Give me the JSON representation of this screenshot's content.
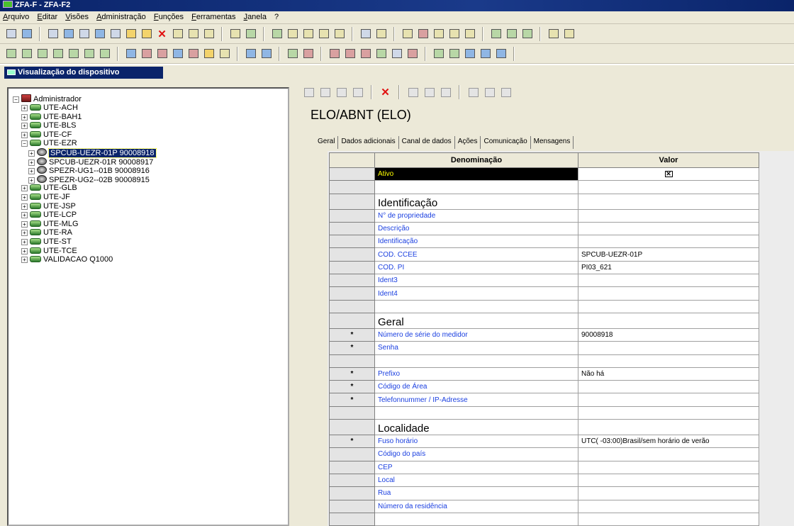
{
  "window": {
    "title": "ZFA-F - ZFA-F2"
  },
  "menu": [
    "Arquivo",
    "Editar",
    "Visões",
    "Administração",
    "Funções",
    "Ferramentas",
    "Janela",
    "?"
  ],
  "panel": {
    "title": "Visualização do dispositivo"
  },
  "tree": {
    "root": "Administrador",
    "items": [
      {
        "label": "UTE-ACH",
        "expanded": false
      },
      {
        "label": "UTE-BAH1",
        "expanded": false
      },
      {
        "label": "UTE-BLS",
        "expanded": false
      },
      {
        "label": "UTE-CF",
        "expanded": false
      },
      {
        "label": "UTE-EZR",
        "expanded": true
      },
      {
        "label": "SPCUB-UEZR-01P  90008918",
        "child": true,
        "selected": true
      },
      {
        "label": "SPCUB-UEZR-01R  90008917",
        "child": true
      },
      {
        "label": "SPEZR-UG1--01B  90008916",
        "child": true
      },
      {
        "label": "SPEZR-UG2--02B  90008915",
        "child": true
      },
      {
        "label": "UTE-GLB",
        "expanded": false
      },
      {
        "label": "UTE-JF",
        "expanded": false
      },
      {
        "label": "UTE-JSP",
        "expanded": false
      },
      {
        "label": "UTE-LCP",
        "expanded": false
      },
      {
        "label": "UTE-MLG",
        "expanded": false
      },
      {
        "label": "UTE-RA",
        "expanded": false
      },
      {
        "label": "UTE-ST",
        "expanded": false
      },
      {
        "label": "UTE-TCE",
        "expanded": false
      },
      {
        "label": "VALIDACAO Q1000",
        "expanded": false
      }
    ]
  },
  "device": {
    "title": "ELO/ABNT (ELO)"
  },
  "tabs": [
    "Geral",
    "Dados adicionais",
    "Canal de dados",
    "Ações",
    "Comunicação",
    "Mensagens"
  ],
  "grid": {
    "headers": {
      "name": "Denominação",
      "value": "Valor"
    },
    "rows": [
      {
        "type": "active",
        "marker": "",
        "name": "Ativo",
        "value": "✕"
      },
      {
        "type": "blank"
      },
      {
        "type": "section",
        "name": "Identificação"
      },
      {
        "type": "field",
        "marker": "",
        "name": "N° de propriedade",
        "value": ""
      },
      {
        "type": "field",
        "marker": "",
        "name": "Descrição",
        "value": ""
      },
      {
        "type": "field",
        "marker": "",
        "name": "Identificação",
        "value": ""
      },
      {
        "type": "field",
        "marker": "",
        "name": "COD. CCEE",
        "value": "SPCUB-UEZR-01P"
      },
      {
        "type": "field",
        "marker": "",
        "name": "COD. PI",
        "value": "PI03_621"
      },
      {
        "type": "field",
        "marker": "",
        "name": "Ident3",
        "value": ""
      },
      {
        "type": "field",
        "marker": "",
        "name": "Ident4",
        "value": ""
      },
      {
        "type": "blank"
      },
      {
        "type": "section",
        "name": "Geral"
      },
      {
        "type": "field",
        "marker": "*",
        "name": "Número de série do medidor",
        "value": "90008918"
      },
      {
        "type": "field",
        "marker": "*",
        "name": "Senha",
        "value": ""
      },
      {
        "type": "blank"
      },
      {
        "type": "field",
        "marker": "*",
        "name": "Prefixo",
        "value": "Não há"
      },
      {
        "type": "field",
        "marker": "*",
        "name": "Código de Área",
        "value": ""
      },
      {
        "type": "field",
        "marker": "*",
        "name": "Telefonnummer / IP-Adresse",
        "value": ""
      },
      {
        "type": "blank"
      },
      {
        "type": "section",
        "name": "Localidade"
      },
      {
        "type": "field",
        "marker": "*",
        "name": "Fuso horário",
        "value": "UTC( -03:00)Brasil/sem horário de verão"
      },
      {
        "type": "field",
        "marker": "",
        "name": "Código do país",
        "value": ""
      },
      {
        "type": "field",
        "marker": "",
        "name": "CEP",
        "value": ""
      },
      {
        "type": "field",
        "marker": "",
        "name": "Local",
        "value": ""
      },
      {
        "type": "field",
        "marker": "",
        "name": "Rua",
        "value": ""
      },
      {
        "type": "field",
        "marker": "",
        "name": "Número da residência",
        "value": ""
      },
      {
        "type": "blank"
      }
    ]
  }
}
